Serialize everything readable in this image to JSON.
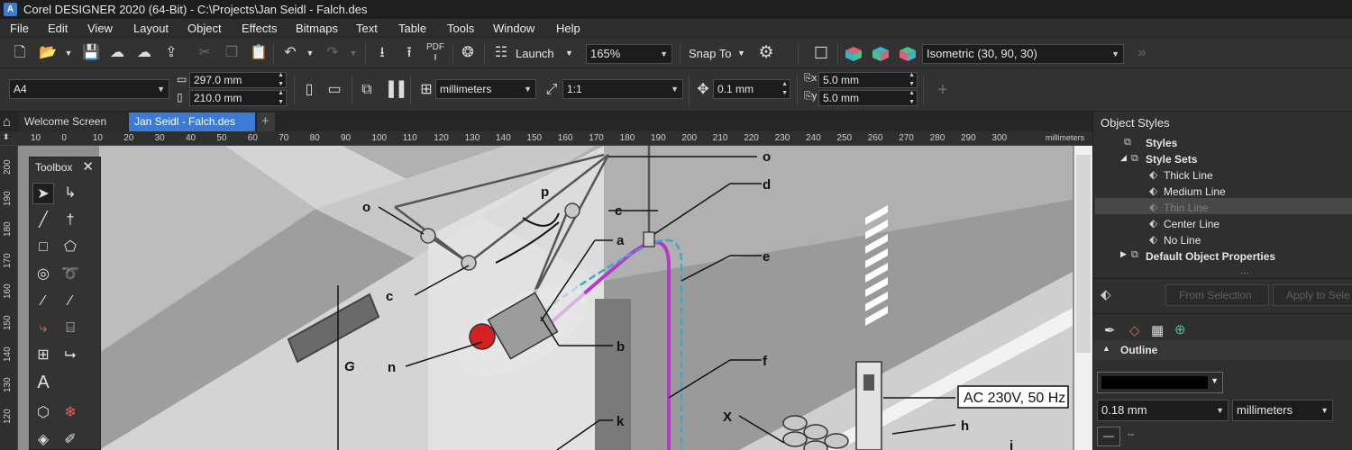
{
  "window": {
    "title": "Corel DESIGNER 2020 (64-Bit) - C:\\Projects\\Jan Seidl - Falch.des"
  },
  "menu": [
    "File",
    "Edit",
    "View",
    "Layout",
    "Object",
    "Effects",
    "Bitmaps",
    "Text",
    "Table",
    "Tools",
    "Window",
    "Help"
  ],
  "standard_toolbar": {
    "launch_label": "Launch",
    "zoom_value": "165%",
    "snap_label": "Snap To",
    "projection_value": "Isometric (30, 90, 30)"
  },
  "property_bar": {
    "page_size": "A4",
    "width": "297.0 mm",
    "height": "210.0 mm",
    "units": "millimeters",
    "scale": "1:1",
    "nudge": "0.1 mm",
    "dup_x": "5.0 mm",
    "dup_y": "5.0 mm"
  },
  "tabs": [
    {
      "label": "Welcome Screen"
    },
    {
      "label": "Jan Seidl - Falch.des"
    }
  ],
  "ruler": {
    "labels": [
      "10",
      "0",
      "10",
      "20",
      "30",
      "40",
      "50",
      "60",
      "70",
      "80",
      "90",
      "100",
      "110",
      "120",
      "130",
      "140",
      "150",
      "160",
      "170",
      "180",
      "190",
      "200",
      "210",
      "220",
      "230",
      "240",
      "250",
      "260",
      "270",
      "280",
      "290",
      "300"
    ],
    "unit": "millimeters",
    "v_labels": [
      "200",
      "190",
      "180",
      "170",
      "160",
      "150",
      "140",
      "130",
      "120"
    ]
  },
  "toolbox": {
    "title": "Toolbox"
  },
  "drawing": {
    "labels": [
      "o",
      "p",
      "c",
      "o",
      "d",
      "a",
      "e",
      "c",
      "b",
      "G",
      "n",
      "f",
      "k",
      "X",
      "h",
      "i"
    ],
    "voltage_label": "AC 230V, 50 Hz"
  },
  "docker": {
    "title": "Object Styles",
    "tree": [
      {
        "label": "Styles"
      },
      {
        "label": "Style Sets"
      },
      {
        "label": "Thick Line"
      },
      {
        "label": "Medium Line"
      },
      {
        "label": "Thin Line"
      },
      {
        "label": "Center Line"
      },
      {
        "label": "No Line"
      },
      {
        "label": "Default Object Properties"
      }
    ],
    "from_selection": "From Selection",
    "apply_to_selection": "Apply to Sele",
    "outline_header": "Outline",
    "outline_width": "0.18 mm",
    "outline_units": "millimeters"
  },
  "colors": {
    "cable_purple": "#b23cc8",
    "cable_cyan": "#3fa8c8",
    "accent_red": "#d42020",
    "active_tab": "#3a7bd5"
  }
}
